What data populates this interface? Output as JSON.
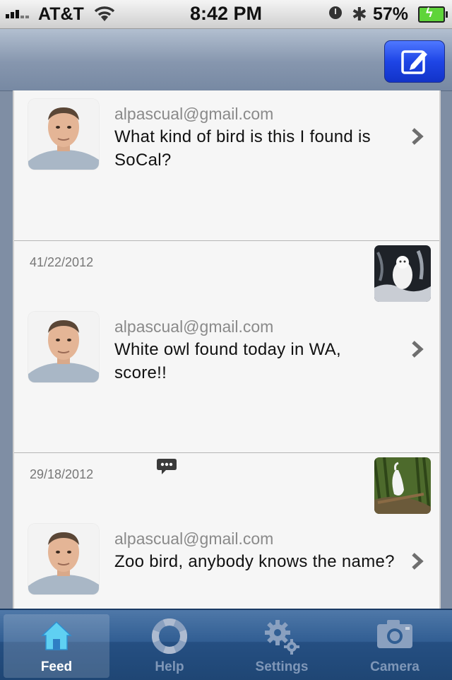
{
  "status_bar": {
    "carrier": "AT&T",
    "time": "8:42 PM",
    "battery": "57%"
  },
  "navbar": {
    "compose_icon": "compose-icon"
  },
  "feed": {
    "posts": [
      {
        "email": "alpascual@gmail.com",
        "text": "What kind of bird is this I found is SoCal?"
      },
      {
        "date": "41/22/2012",
        "email": "alpascual@gmail.com",
        "text": "White owl found today in WA, score!!",
        "thumb": "owl-photo"
      },
      {
        "date": "29/18/2012",
        "email": "alpascual@gmail.com",
        "text": "Zoo bird, anybody knows the name?",
        "thumb": "egret-photo"
      }
    ]
  },
  "tabbar": {
    "tabs": [
      {
        "label": "Feed",
        "icon": "home-icon",
        "active": true
      },
      {
        "label": "Help",
        "icon": "lifebuoy-icon",
        "active": false
      },
      {
        "label": "Settings",
        "icon": "gears-icon",
        "active": false
      },
      {
        "label": "Camera",
        "icon": "camera-icon",
        "active": false
      }
    ]
  },
  "colors": {
    "nav_bar": "#8696ae",
    "compose_button": "#1e45e6",
    "tab_bar": "#254f82",
    "tab_active_label": "#ffffff"
  }
}
